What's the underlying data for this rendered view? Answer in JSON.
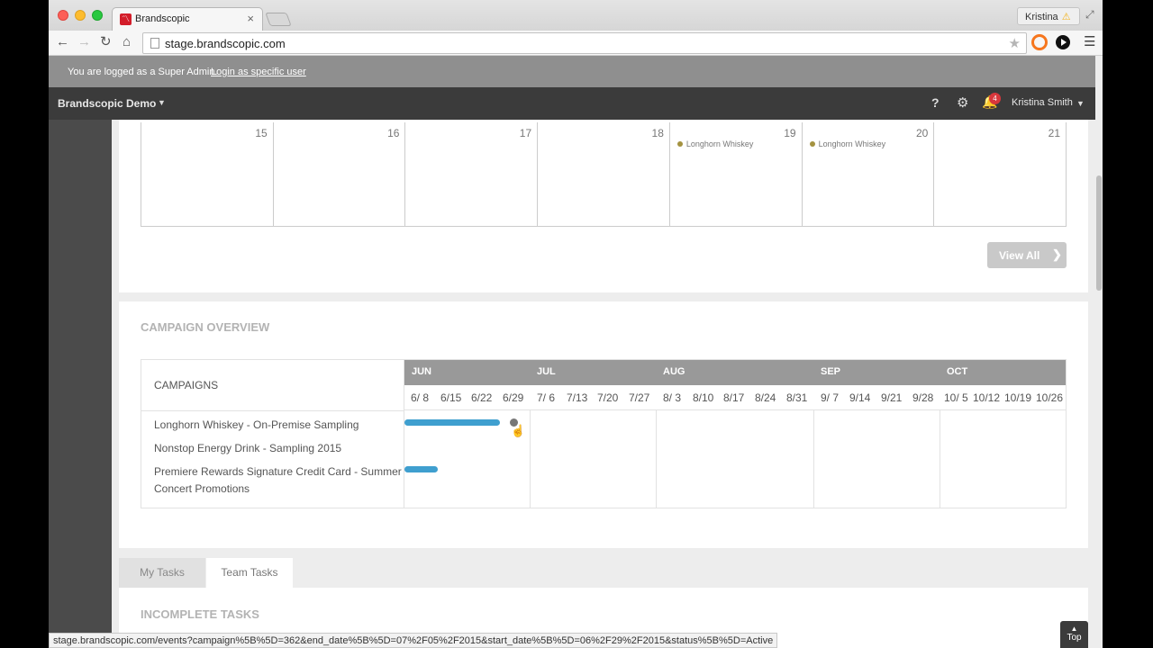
{
  "browser": {
    "tab_title": "Brandscopic",
    "tab_close": "×",
    "profile_name": "Kristina",
    "profile_warn": "⚠",
    "url": "stage.brandscopic.com",
    "status_url": "stage.brandscopic.com/events?campaign%5B%5D=362&end_date%5B%5D=07%2F05%2F2015&start_date%5B%5D=06%2F29%2F2015&status%5B%5D=Active"
  },
  "admin_bar": {
    "message": "You are logged as a Super Admin.",
    "link": "Login as specific user"
  },
  "header": {
    "brand": "Brandscopic Demo",
    "help": "?",
    "notification_count": "4",
    "user_name": "Kristina Smith"
  },
  "calendar": {
    "days": [
      {
        "day": "15",
        "event": ""
      },
      {
        "day": "16",
        "event": ""
      },
      {
        "day": "17",
        "event": ""
      },
      {
        "day": "18",
        "event": ""
      },
      {
        "day": "19",
        "event": "Longhorn Whiskey"
      },
      {
        "day": "20",
        "event": "Longhorn Whiskey"
      },
      {
        "day": "21",
        "event": ""
      }
    ],
    "view_all_label": "View All"
  },
  "campaign_overview": {
    "title": "CAMPAIGN OVERVIEW",
    "column_header": "CAMPAIGNS",
    "months": [
      "JUN",
      "JUL",
      "AUG",
      "SEP",
      "OCT"
    ],
    "weeks": [
      "6/ 8",
      "6/15",
      "6/22",
      "6/29",
      "7/ 6",
      "7/13",
      "7/20",
      "7/27",
      "8/ 3",
      "8/10",
      "8/17",
      "8/24",
      "8/31",
      "9/ 7",
      "9/14",
      "9/21",
      "9/28",
      "10/ 5",
      "10/12",
      "10/19",
      "10/26"
    ],
    "campaigns": [
      "Longhorn Whiskey - On-Premise Sampling",
      "Nonstop Energy Drink - Sampling 2015",
      "Premiere Rewards Signature Credit Card - Summer Concert Promotions"
    ],
    "bar_color": "#3f9fcf"
  },
  "tasks": {
    "tabs": [
      "My Tasks",
      "Team Tasks"
    ],
    "active_tab": "Team Tasks",
    "section_title": "INCOMPLETE TASKS"
  },
  "scroll_top_label": "Top"
}
